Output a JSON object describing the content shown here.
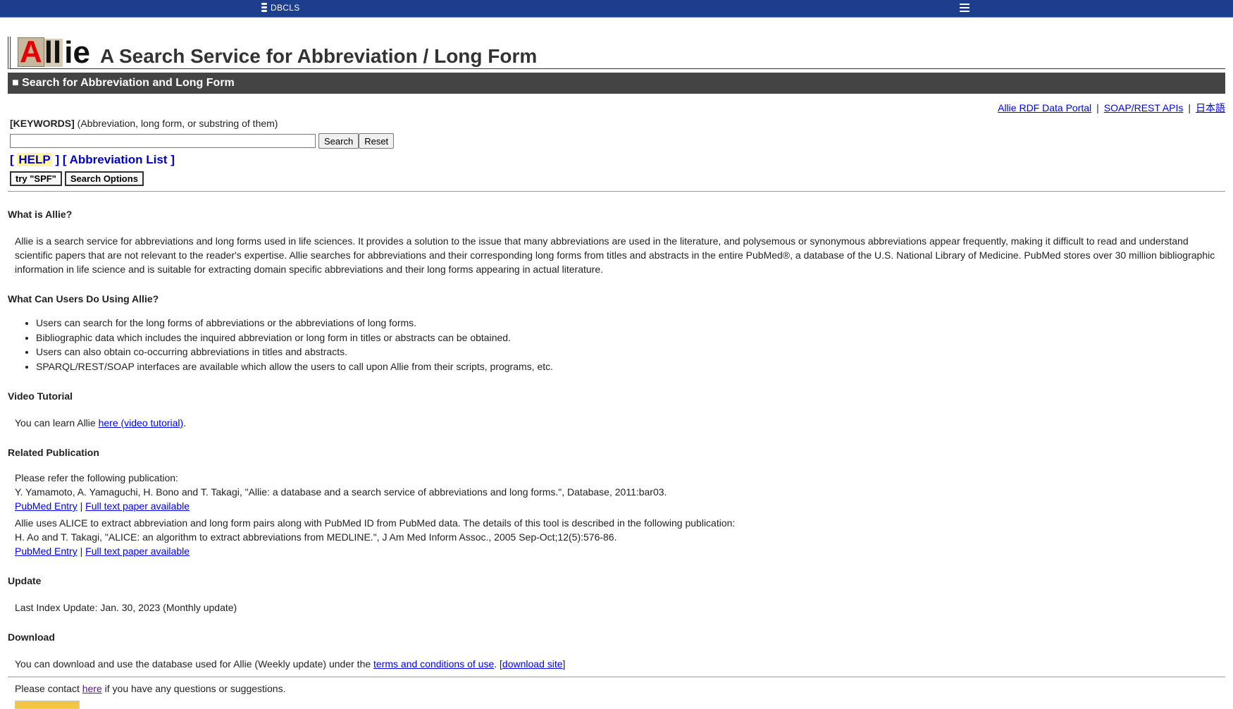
{
  "topbar": {
    "brand": "DBCLS",
    "menu_icon": "hamburger-menu-icon"
  },
  "header": {
    "logo": {
      "first_letter": "A",
      "middle": "ll",
      "rest": "ie"
    },
    "title": "A Search Service for Abbreviation / Long Form"
  },
  "section_title": "■ Search for Abbreviation and Long Form",
  "top_links": [
    {
      "label": "Allie RDF Data Portal"
    },
    {
      "label": "SOAP/REST APIs"
    },
    {
      "label": "日本語"
    }
  ],
  "search": {
    "keywords_label": "[KEYWORDS]",
    "keywords_hint": " (Abbreviation, long form, or substring of them)",
    "input_value": "",
    "search_button": "Search",
    "reset_button": "Reset",
    "help_link": "HELP",
    "abbrev_list_link": "Abbreviation List",
    "try_button": "try \"SPF\"",
    "options_button": "Search Options"
  },
  "about": {
    "heading": "What is Allie?",
    "text": "Allie is a search service for abbreviations and long forms used in life sciences. It provides a solution to the issue that many abbreviations are used in the literature, and polysemous or synonymous abbreviations appear frequently, making it difficult to read and understand scientific papers that are not relevant to the reader's expertise. Allie searches for abbreviations and their corresponding long forms from titles and abstracts in the entire PubMed®, a database of the U.S. National Library of Medicine. PubMed stores over 30 million bibliographic information in life science and is suitable for extracting domain specific abbreviations and their long forms appearing in actual literature."
  },
  "features": {
    "heading": "What Can Users Do Using Allie?",
    "items": [
      "Users can search for the long forms of abbreviations or the abbreviations of long forms.",
      "Bibliographic data which includes the inquired abbreviation or long form in titles or abstracts can be obtained.",
      "Users can also obtain co-occurring abbreviations in titles and abstracts.",
      "SPARQL/REST/SOAP interfaces are available which allow the users to call upon Allie from their scripts, programs, etc."
    ]
  },
  "video": {
    "heading": "Video Tutorial",
    "prefix": "You can learn Allie ",
    "link": "here (video tutorial)",
    "suffix": "."
  },
  "publication": {
    "heading": "Related Publication",
    "intro": "Please refer the following publication:",
    "citation1": "Y. Yamamoto, A. Yamaguchi, H. Bono and T. Takagi, \"Allie: a database and a search service of abbreviations and long forms.\", Database, 2011:bar03.",
    "pubmed_link": "PubMed Entry",
    "fulltext_link": "Full text paper available",
    "alice_intro": "Allie uses ALICE to extract abbreviation and long form pairs along with PubMed ID from PubMed data. The details of this tool is described in the following publication:",
    "citation2": "H. Ao and T. Takagi, \"ALICE: an algorithm to extract abbreviations from MEDLINE.\", J Am Med Inform Assoc., 2005 Sep-Oct;12(5):576-86.",
    "separator": " | "
  },
  "update": {
    "heading": "Update",
    "text": "Last Index Update: Jan. 30, 2023 (Monthly update)"
  },
  "download": {
    "heading": "Download",
    "prefix": "You can download and use the database used for Allie (Weekly update) under the ",
    "terms_link": "terms and conditions of use",
    "mid": ". [",
    "site_link": "download site",
    "suffix": "]"
  },
  "contact": {
    "prefix": "Please contact ",
    "link": "here",
    "suffix": " if you have any questions or suggestions."
  }
}
